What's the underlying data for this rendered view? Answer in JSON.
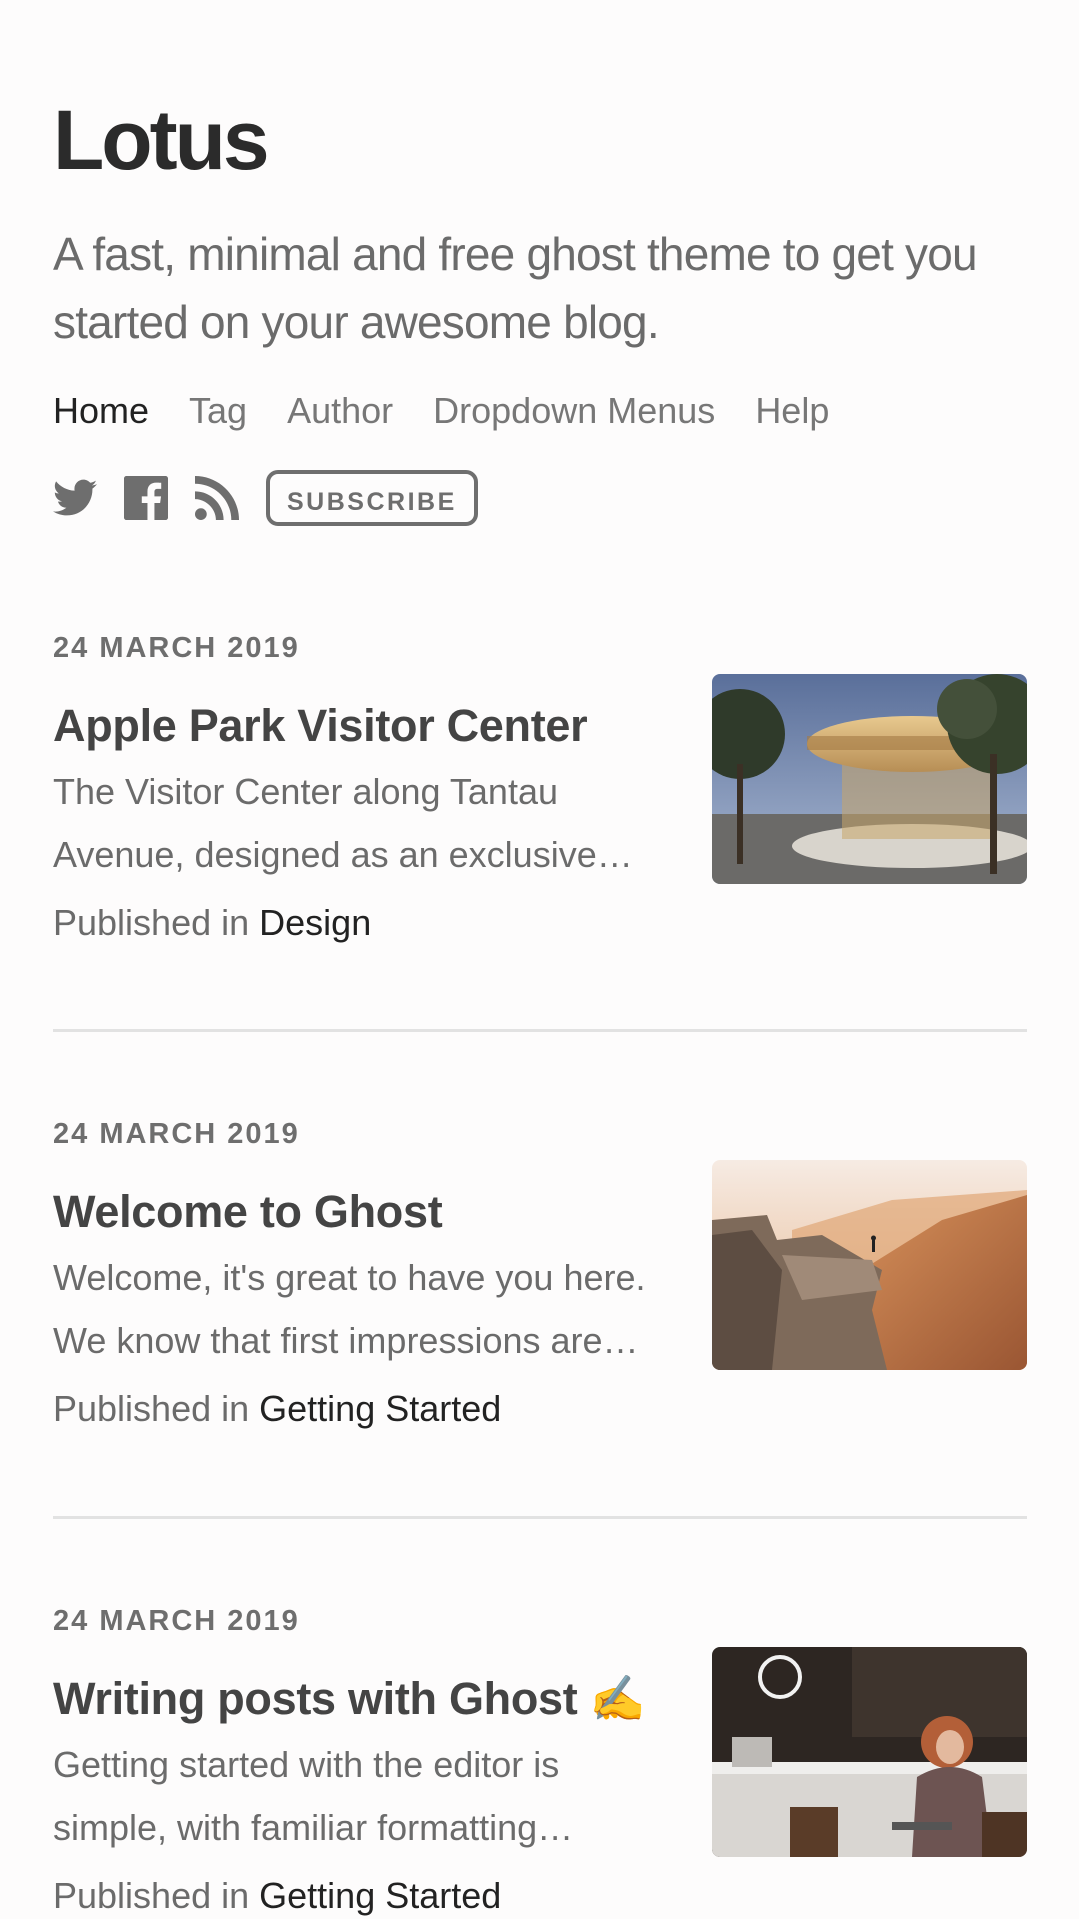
{
  "site": {
    "title": "Lotus",
    "description": "A fast, minimal and free ghost theme to get you started on your awesome blog."
  },
  "nav": [
    {
      "label": "Home",
      "active": true
    },
    {
      "label": "Tag"
    },
    {
      "label": "Author"
    },
    {
      "label": "Dropdown Menus"
    },
    {
      "label": "Help"
    }
  ],
  "social": {
    "icons": [
      "twitter-icon",
      "facebook-icon",
      "rss-icon"
    ],
    "subscribe_label": "SUBSCRIBE"
  },
  "posts": [
    {
      "date": "24 MARCH 2019",
      "title": "Apple Park Visitor Center",
      "excerpt": "The Visitor Center along Tantau Avenue, designed as an exclusive…",
      "published_prefix": "Published in",
      "tag": "Design",
      "image": "apple-park-photo"
    },
    {
      "date": "24 MARCH 2019",
      "title": "Welcome to Ghost",
      "excerpt": "Welcome, it's great to have you here. We know that first impressions are…",
      "published_prefix": "Published in",
      "tag": "Getting Started",
      "image": "cliff-photo"
    },
    {
      "date": "24 MARCH 2019",
      "title": "Writing posts with Ghost ✍️",
      "excerpt": "Getting started with the editor is simple, with familiar formatting…",
      "published_prefix": "Published in",
      "tag": "Getting Started",
      "image": "cafe-photo"
    }
  ]
}
